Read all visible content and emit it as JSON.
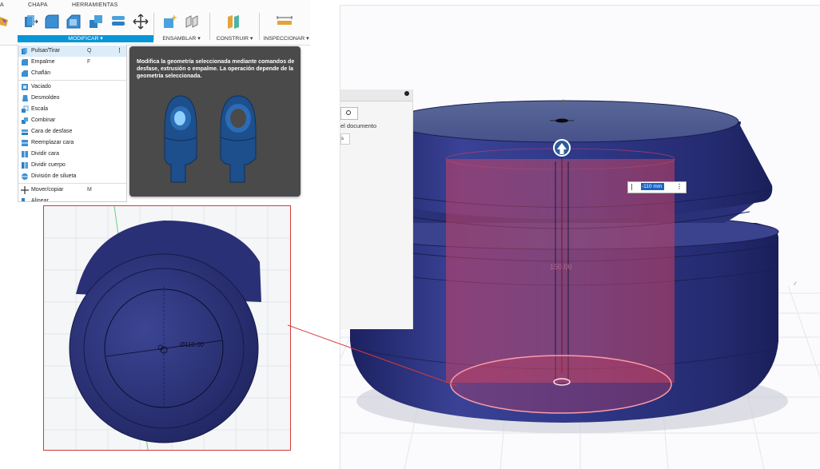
{
  "toolbar": {
    "tabs": [
      "CHAPA",
      "HERRAMIENTAS"
    ],
    "groups": {
      "modificar": "MODIFICAR ▾",
      "ensamblar": "ENSAMBLAR ▾",
      "construir": "CONSTRUIR ▾",
      "inspeccionar": "INSPECCIONAR ▾"
    },
    "tab_partial": "A"
  },
  "menu": {
    "items": [
      {
        "label": "Pulsar/Tirar",
        "shortcut": "Q",
        "icon": "press-pull-icon"
      },
      {
        "label": "Empalme",
        "shortcut": "F",
        "icon": "fillet-icon"
      },
      {
        "label": "Chaflán",
        "shortcut": "",
        "icon": "chamfer-icon"
      },
      {
        "label": "Vaciado",
        "shortcut": "",
        "icon": "shell-icon"
      },
      {
        "label": "Desmoldeo",
        "shortcut": "",
        "icon": "draft-icon"
      },
      {
        "label": "Escala",
        "shortcut": "",
        "icon": "scale-icon"
      },
      {
        "label": "Combinar",
        "shortcut": "",
        "icon": "combine-icon"
      },
      {
        "label": "Cara de desfase",
        "shortcut": "",
        "icon": "offset-face-icon"
      },
      {
        "label": "Reemplazar cara",
        "shortcut": "",
        "icon": "replace-face-icon"
      },
      {
        "label": "Dividir cara",
        "shortcut": "",
        "icon": "split-face-icon"
      },
      {
        "label": "Dividir cuerpo",
        "shortcut": "",
        "icon": "split-body-icon"
      },
      {
        "label": "División de silueta",
        "shortcut": "",
        "icon": "silhouette-split-icon"
      },
      {
        "label": "Mover/copiar",
        "shortcut": "M",
        "icon": "move-icon"
      },
      {
        "label": "Alinear",
        "shortcut": "",
        "icon": "align-icon"
      }
    ],
    "more_options": "⋮"
  },
  "tooltip": {
    "text": "Modifica la geometría seleccionada mediante comandos de desfase, extrusión o empalme. La operación depende de la geometría seleccionada."
  },
  "panel": {
    "document_label": "el documento"
  },
  "viewport": {
    "dimension_value": "-110 mm",
    "dimension_more": "⋮",
    "height_label": "150.00"
  },
  "inset": {
    "diameter_label": "Ø110.00"
  },
  "colors": {
    "accent": "#0696d7",
    "body": "#2e3580",
    "highlight": "#d9455b",
    "inset_border": "#d23b3b"
  }
}
